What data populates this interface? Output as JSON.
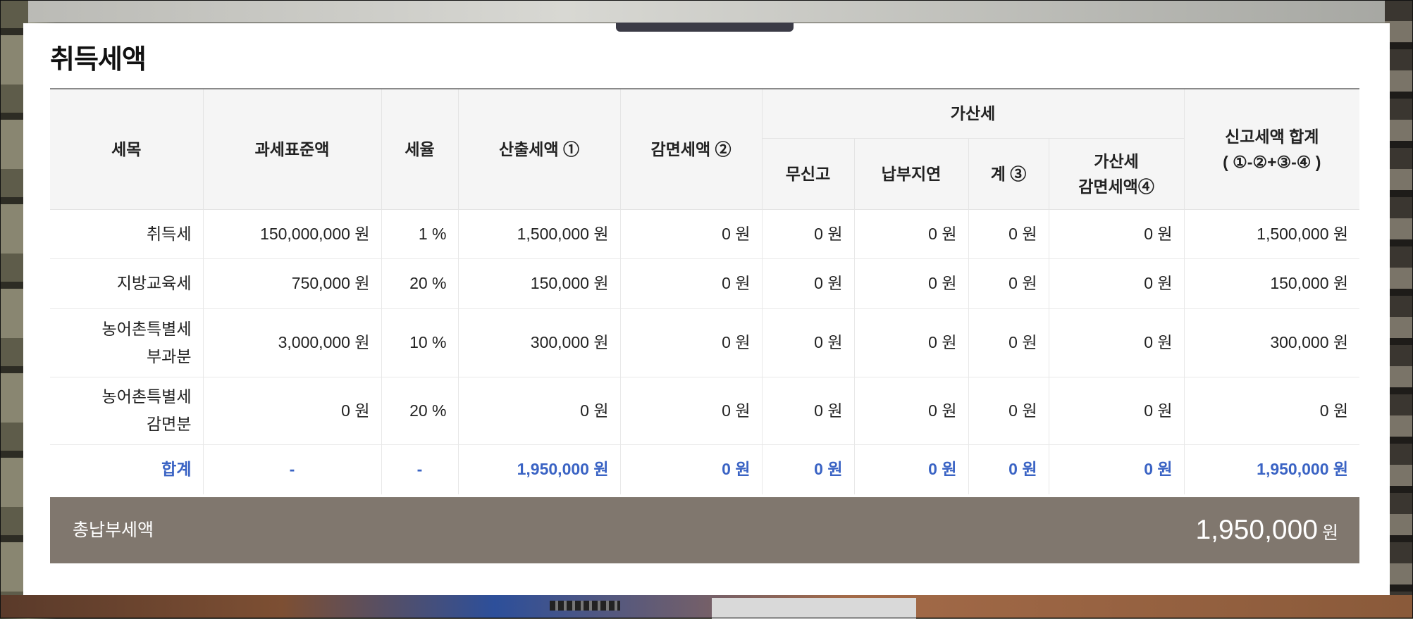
{
  "title": "취득세액",
  "table": {
    "headers": {
      "item": "세목",
      "tax_base": "과세표준액",
      "rate": "세율",
      "computed_tax": "산출세액 ①",
      "reduced_tax": "감면세액 ②",
      "penalty_group": "가산세",
      "no_report": "무신고",
      "late_payment": "납부지연",
      "penalty_subtotal": "계 ③",
      "penalty_reduction_line1": "가산세",
      "penalty_reduction_line2": "감면세액④",
      "report_total_line1": "신고세액 합계",
      "report_total_line2": "( ①-②+③-④ )"
    },
    "rows": [
      {
        "item": "취득세",
        "item2": "",
        "tax_base": "150,000,000 원",
        "rate": "1 %",
        "computed": "1,500,000 원",
        "reduced": "0 원",
        "no_report": "0 원",
        "late": "0 원",
        "subtotal": "0 원",
        "penalty_reduction": "0 원",
        "total": "1,500,000 원"
      },
      {
        "item": "지방교육세",
        "item2": "",
        "tax_base": "750,000 원",
        "rate": "20 %",
        "computed": "150,000 원",
        "reduced": "0 원",
        "no_report": "0 원",
        "late": "0 원",
        "subtotal": "0 원",
        "penalty_reduction": "0 원",
        "total": "150,000 원"
      },
      {
        "item": "농어촌특별세",
        "item2": "부과분",
        "tax_base": "3,000,000 원",
        "rate": "10 %",
        "computed": "300,000 원",
        "reduced": "0 원",
        "no_report": "0 원",
        "late": "0 원",
        "subtotal": "0 원",
        "penalty_reduction": "0 원",
        "total": "300,000 원"
      },
      {
        "item": "농어촌특별세",
        "item2": "감면분",
        "tax_base": "0 원",
        "rate": "20 %",
        "computed": "0 원",
        "reduced": "0 원",
        "no_report": "0 원",
        "late": "0 원",
        "subtotal": "0 원",
        "penalty_reduction": "0 원",
        "total": "0 원"
      }
    ],
    "total_row": {
      "item": "합계",
      "tax_base": "-",
      "rate": "-",
      "computed": "1,950,000 원",
      "reduced": "0 원",
      "no_report": "0 원",
      "late": "0 원",
      "subtotal": "0 원",
      "penalty_reduction": "0 원",
      "total": "1,950,000 원"
    }
  },
  "summary": {
    "label": "총납부세액",
    "amount": "1,950,000",
    "unit": "원"
  },
  "colors": {
    "total_text": "#3a63c4",
    "summary_bar": "#80776e",
    "header_bg": "#f5f5f5"
  }
}
